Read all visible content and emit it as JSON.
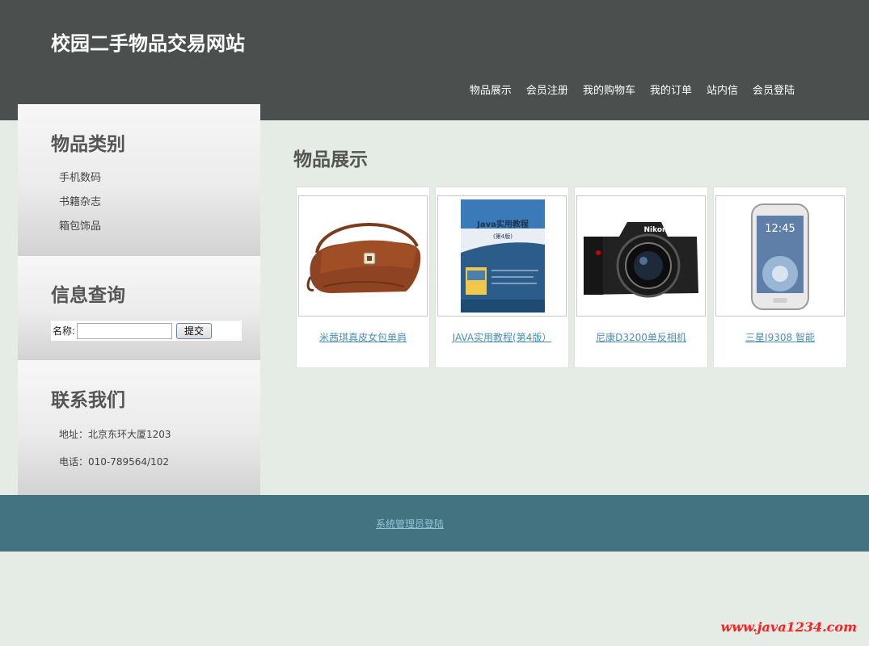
{
  "header": {
    "site_title": "校园二手物品交易网站",
    "nav": [
      "物品展示",
      "会员注册",
      "我的购物车",
      "我的订单",
      "站内信",
      "会员登陆"
    ]
  },
  "sidebar": {
    "categories": {
      "title": "物品类别",
      "items": [
        "手机数码",
        "书籍杂志",
        "箱包饰品"
      ]
    },
    "search": {
      "title": "信息查询",
      "name_label": "名称:",
      "input_value": "",
      "submit_label": "提交"
    },
    "contact": {
      "title": "联系我们",
      "address": "地址：北京东环大厦1203",
      "phone": "电话：010-789564/102"
    }
  },
  "main": {
    "title": "物品展示",
    "products": [
      {
        "name": "米茜琪真皮女包单肩",
        "icon": "handbag-image"
      },
      {
        "name": "JAVA实用教程(第4版）",
        "icon": "book-image",
        "cover_title": "Java实用教程",
        "cover_subtitle": "(第4版)"
      },
      {
        "name": "尼康D3200单反相机",
        "icon": "camera-image",
        "brand": "Nikon"
      },
      {
        "name": "三星I9308 智能",
        "icon": "smartphone-image",
        "screen_time": "12:45"
      }
    ]
  },
  "footer": {
    "admin_link": "系统管理员登陆"
  },
  "watermark": "www.java1234.com",
  "colors": {
    "header_bg": "#4b504e",
    "page_bg": "#e5ebe5",
    "footer_bg": "#437281",
    "link": "#4a8fb0",
    "watermark": "#ff2020"
  }
}
